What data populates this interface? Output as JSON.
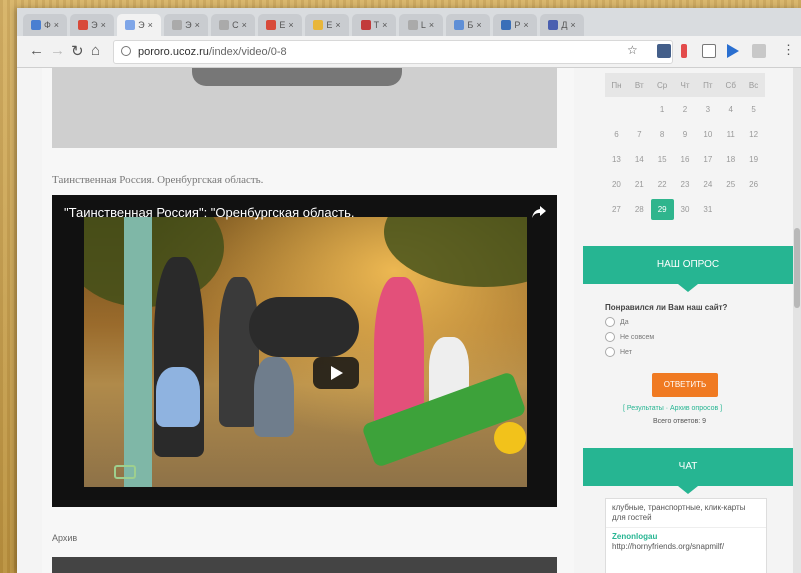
{
  "browser": {
    "url_host": "pororo.ucoz.ru",
    "url_path": "/index/video/0-8",
    "tabs": [
      {
        "label": "Ф",
        "active": false,
        "color": "#4a7fd1"
      },
      {
        "label": "Э",
        "active": false,
        "color": "#d84a3a"
      },
      {
        "label": "Э",
        "active": true,
        "color": "#7fa6e8"
      },
      {
        "label": "Э",
        "active": false,
        "color": "#aaaaaa"
      },
      {
        "label": "С",
        "active": false,
        "color": "#aaaaaa"
      },
      {
        "label": "Е",
        "active": false,
        "color": "#d84a3a"
      },
      {
        "label": "Е",
        "active": false,
        "color": "#e8b63a"
      },
      {
        "label": "Т",
        "active": false,
        "color": "#c23b3b"
      },
      {
        "label": "L",
        "active": false,
        "color": "#aaaaaa"
      },
      {
        "label": "Б",
        "active": false,
        "color": "#5f8fd6"
      },
      {
        "label": "Р",
        "active": false,
        "color": "#3a6fb8"
      },
      {
        "label": "Д",
        "active": false,
        "color": "#4a5fb0"
      }
    ]
  },
  "main": {
    "caption": "Таинственная Россия. Оренбургская область.",
    "video_title": "\"Таинственная Россия\": \"Оренбургская область.",
    "archive_label": "Архив"
  },
  "sidebar": {
    "calendar": {
      "weekdays": [
        "Пн",
        "Вт",
        "Ср",
        "Чт",
        "Пт",
        "Сб",
        "Вс"
      ],
      "weeks": [
        [
          "",
          "",
          "",
          "1",
          "2",
          "3",
          "4",
          "5"
        ],
        [
          "6",
          "7",
          "8",
          "9",
          "10",
          "11",
          "12"
        ],
        [
          "13",
          "14",
          "15",
          "16",
          "17",
          "18",
          "19"
        ],
        [
          "20",
          "21",
          "22",
          "23",
          "24",
          "25",
          "26"
        ],
        [
          "27",
          "28",
          "29",
          "30",
          "31",
          "",
          ""
        ]
      ],
      "today": "29"
    },
    "poll": {
      "header": "НАШ ОПРОС",
      "question": "Понравился ли Вам наш сайт?",
      "options": [
        "Да",
        "Не совсем",
        "Нет"
      ],
      "vote_button": "ОТВЕТИТЬ",
      "links": "[ Результаты · Архив опросов ]",
      "total": "Всего ответов: 9"
    },
    "chat": {
      "header": "ЧАТ",
      "message1": "клубные, транспортные, клик-карты для гостей",
      "author": "Zenonlogau",
      "message2": "http://hornyfriends.org/snapmilf/"
    }
  },
  "colors": {
    "accent": "#26b592",
    "vote": "#f07a22"
  }
}
